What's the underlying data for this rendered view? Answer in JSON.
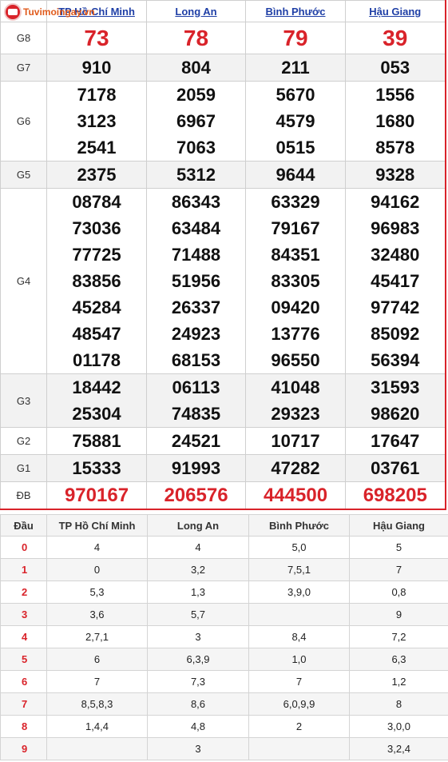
{
  "site": {
    "logo_text": "Tuvimoingay.vn",
    "accent_color": "#d9232a"
  },
  "provinces": [
    "TP Hồ Chí Minh",
    "Long An",
    "Bình Phước",
    "Hậu Giang"
  ],
  "prizes": [
    {
      "label": "G8",
      "values": [
        [
          "73"
        ],
        [
          "78"
        ],
        [
          "79"
        ],
        [
          "39"
        ]
      ],
      "highlight": true
    },
    {
      "label": "G7",
      "values": [
        [
          "910"
        ],
        [
          "804"
        ],
        [
          "211"
        ],
        [
          "053"
        ]
      ]
    },
    {
      "label": "G6",
      "values": [
        [
          "7178",
          "3123",
          "2541"
        ],
        [
          "2059",
          "6967",
          "7063"
        ],
        [
          "5670",
          "4579",
          "0515"
        ],
        [
          "1556",
          "1680",
          "8578"
        ]
      ]
    },
    {
      "label": "G5",
      "values": [
        [
          "2375"
        ],
        [
          "5312"
        ],
        [
          "9644"
        ],
        [
          "9328"
        ]
      ]
    },
    {
      "label": "G4",
      "values": [
        [
          "08784",
          "73036",
          "77725",
          "83856",
          "45284",
          "48547",
          "01178"
        ],
        [
          "86343",
          "63484",
          "71488",
          "51956",
          "26337",
          "24923",
          "68153"
        ],
        [
          "63329",
          "79167",
          "84351",
          "83305",
          "09420",
          "13776",
          "96550"
        ],
        [
          "94162",
          "96983",
          "32480",
          "45417",
          "97742",
          "85092",
          "56394"
        ]
      ]
    },
    {
      "label": "G3",
      "values": [
        [
          "18442",
          "25304"
        ],
        [
          "06113",
          "74835"
        ],
        [
          "41048",
          "29323"
        ],
        [
          "31593",
          "98620"
        ]
      ]
    },
    {
      "label": "G2",
      "values": [
        [
          "75881"
        ],
        [
          "24521"
        ],
        [
          "10717"
        ],
        [
          "17647"
        ]
      ]
    },
    {
      "label": "G1",
      "values": [
        [
          "15333"
        ],
        [
          "91993"
        ],
        [
          "47282"
        ],
        [
          "03761"
        ]
      ]
    },
    {
      "label": "ĐB",
      "values": [
        [
          "970167"
        ],
        [
          "206576"
        ],
        [
          "444500"
        ],
        [
          "698205"
        ]
      ],
      "highlight": true
    }
  ],
  "dau_table": {
    "header": [
      "Đầu",
      "TP Hồ Chí Minh",
      "Long An",
      "Bình Phước",
      "Hậu Giang"
    ],
    "rows": [
      {
        "dau": "0",
        "cells": [
          "4",
          "4",
          "5,0",
          "5"
        ]
      },
      {
        "dau": "1",
        "cells": [
          "0",
          "3,2",
          "7,5,1",
          "7"
        ]
      },
      {
        "dau": "2",
        "cells": [
          "5,3",
          "1,3",
          "3,9,0",
          "0,8"
        ]
      },
      {
        "dau": "3",
        "cells": [
          "3,6",
          "5,7",
          "",
          "9"
        ]
      },
      {
        "dau": "4",
        "cells": [
          "2,7,1",
          "3",
          "8,4",
          "7,2"
        ]
      },
      {
        "dau": "5",
        "cells": [
          "6",
          "6,3,9",
          "1,0",
          "6,3"
        ]
      },
      {
        "dau": "6",
        "cells": [
          "7",
          "7,3",
          "7",
          "1,2"
        ]
      },
      {
        "dau": "7",
        "cells": [
          "8,5,8,3",
          "8,6",
          "6,0,9,9",
          "8"
        ]
      },
      {
        "dau": "8",
        "cells": [
          "1,4,4",
          "4,8",
          "2",
          "3,0,0"
        ]
      },
      {
        "dau": "9",
        "cells": [
          "",
          "3",
          "",
          "3,2,4"
        ]
      }
    ]
  }
}
